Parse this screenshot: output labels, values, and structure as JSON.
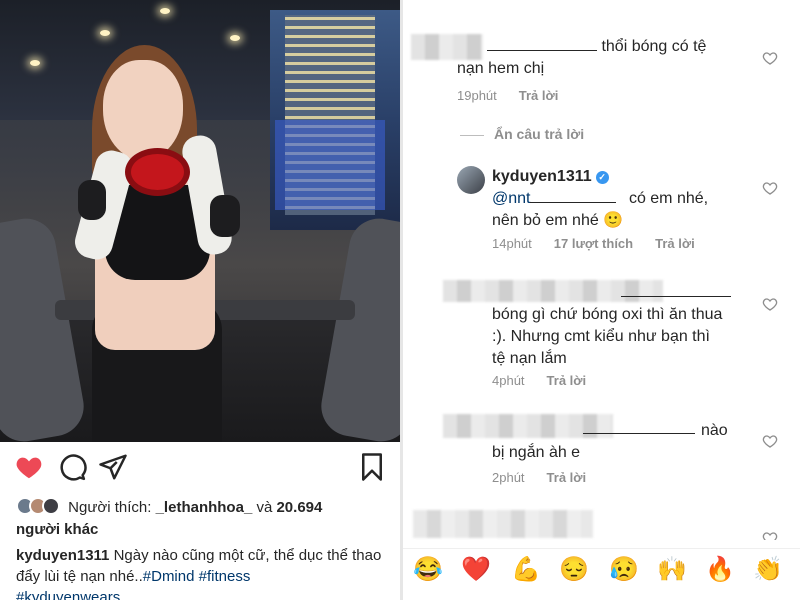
{
  "post": {
    "likes": {
      "prefix": "Người thích: ",
      "user": "_lethanhhoa_",
      "connector": " và ",
      "count": "20.694",
      "suffix": "người khác"
    },
    "caption": {
      "user": "kyduyen1311",
      "text": " Ngày nào cũng một cữ, thể dục thể thao đẩy lùi tệ nạn nhé..",
      "tags": [
        "#Dmind",
        "#fitness",
        "#kyduyenwears"
      ]
    },
    "icons": [
      "heart-icon",
      "comment-icon",
      "share-icon",
      "bookmark-icon"
    ],
    "colors": {
      "liked": "#ed4956",
      "link": "#00376b",
      "meta": "#8e8e8e",
      "verified": "#3897f0"
    }
  },
  "comments": [
    {
      "text_a": "thổi bóng có tệ",
      "text_b": "nạn hem chị",
      "time": "19phút",
      "reply": "Trả lời"
    }
  ],
  "hide_replies": "Ẩn câu trả lời",
  "replies": [
    {
      "user": "kyduyen1311",
      "verified": "✓",
      "mention": "@nnt",
      "text_a": "có em nhé,",
      "text_b": "nên bỏ em nhé",
      "emoji": "🙂",
      "time": "14phút",
      "likes": "17 lượt thích",
      "reply": "Trả lời"
    },
    {
      "line1": "bóng gì chứ bóng oxi thì ăn thua",
      "line2": ":). Nhưng cmt kiểu như bạn thì",
      "line3": "tệ nạn lắm",
      "time": "4phút",
      "reply": "Trả lời"
    },
    {
      "text_a": "nào",
      "text_b": "bị ngắn àh e",
      "time": "2phút",
      "reply": "Trả lời"
    }
  ],
  "emoji_bar": [
    "😂",
    "❤️",
    "💪",
    "😔",
    "😥",
    "🙌",
    "🔥",
    "👏"
  ]
}
